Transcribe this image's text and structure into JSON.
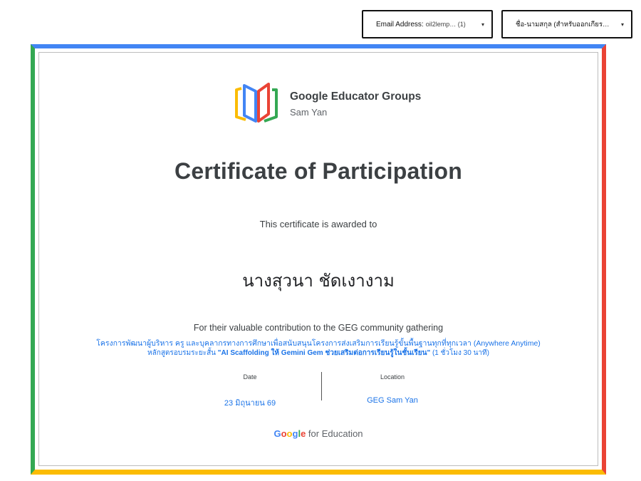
{
  "form": {
    "email_label": "Email Address:",
    "email_value": "oil2lemp… (1)",
    "name_label": "ชื่อ-นามสกุล (สำหรับออกเกียร…"
  },
  "certificate": {
    "org_name": "Google Educator Groups",
    "org_chapter": "Sam Yan",
    "title": "Certificate of Participation",
    "awarded_text": "This certificate is awarded to",
    "recipient": "นางสุวนา ชัดเงางาม",
    "contribution_text": "For their valuable contribution to the GEG community gathering",
    "project_line": "โครงการพัฒนาผู้บริหาร ครู และบุคลากรทางการศึกษาเพื่อสนับสนุนโครงการส่งเสริมการเรียนรู้ขั้นพื้นฐานทุกที่ทุกเวลา (Anywhere Anytime)",
    "course_prefix": "หลักสูตรอบรมระยะสั้น ",
    "course_name": "\"AI Scaffolding ให้ Gemini Gem ช่วยเสริมต่อการเรียนรู้ในชั้นเรียน\"",
    "course_duration": " (1 ชั่วโมง 30 นาที)",
    "date_label": "Date",
    "date_value": "23 มิถุนายน 69",
    "location_label": "Location",
    "location_value": "GEG Sam Yan",
    "footer_google": "Google",
    "footer_rest": " for Education"
  },
  "colors": {
    "blue": "#4285F4",
    "green": "#34A853",
    "red": "#EA4335",
    "yellow": "#FBBC04"
  }
}
